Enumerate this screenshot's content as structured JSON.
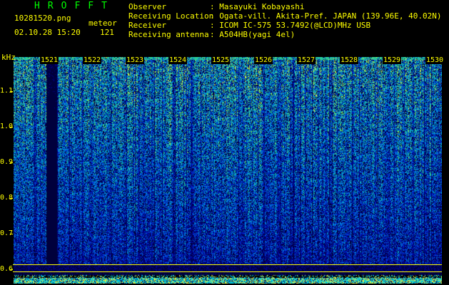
{
  "header": {
    "title": "HROFFT",
    "filename": "10281520.png",
    "datetime": "02.10.28 15:20",
    "mode": "meteor",
    "count": "121",
    "info": [
      {
        "label": "Observer",
        "value": "Masayuki Kobayashi"
      },
      {
        "label": "Receiving Location",
        "value": "Ogata-vill. Akita-Pref. JAPAN (139.96E, 40.02N)"
      },
      {
        "label": "Receiver",
        "value": "ICOM IC-575 53.7492(@LCD)MHz USB"
      },
      {
        "label": "Receiving antenna",
        "value": "A504HB(yagi 4el)"
      }
    ]
  },
  "spectrogram": {
    "yunit": "kHz",
    "yticks": [
      "1.1",
      "1.0",
      "0.9",
      "0.8",
      "0.7",
      "0.6"
    ],
    "xticks": [
      "1521",
      "1522",
      "1523",
      "1524",
      "1525",
      "1526",
      "1527",
      "1528",
      "1529",
      "1530"
    ],
    "colors": {
      "background": "#000000",
      "axis": "#ffff00",
      "title": "#00ff00"
    }
  }
}
